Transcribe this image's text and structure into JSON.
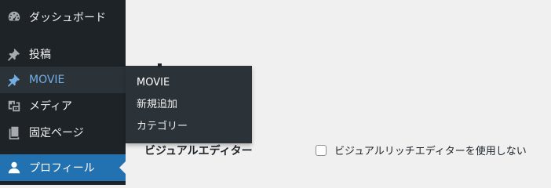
{
  "sidebar": {
    "items": [
      {
        "label": "ダッシュボード",
        "icon": "dashboard-icon"
      },
      {
        "label": "投稿",
        "icon": "pin-icon"
      },
      {
        "label": "MOVIE",
        "icon": "pin-icon"
      },
      {
        "label": "メディア",
        "icon": "media-icon"
      },
      {
        "label": "固定ページ",
        "icon": "page-icon"
      },
      {
        "label": "プロフィール",
        "icon": "user-icon"
      }
    ]
  },
  "flyout": {
    "items": [
      {
        "label": "MOVIE"
      },
      {
        "label": "新規追加"
      },
      {
        "label": "カテゴリー"
      }
    ]
  },
  "content": {
    "field_label": "ビジュアルエディター",
    "checkbox_label": "ビジュアルリッチエディターを使用しない",
    "checkbox_checked": false
  },
  "colors": {
    "sidebar_bg": "#1d2327",
    "hover_bg": "#2c3338",
    "hover_text": "#72aee6",
    "current_bg": "#2271b1",
    "content_bg": "#f0f0f1"
  }
}
